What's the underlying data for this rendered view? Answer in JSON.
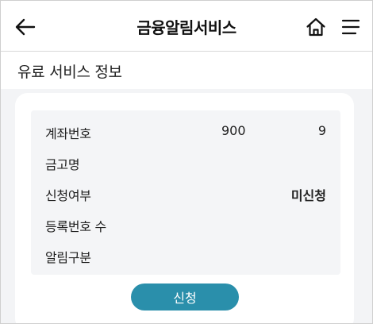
{
  "header": {
    "title": "금융알림서비스",
    "back_icon": "arrow-left-icon",
    "home_icon": "home-icon",
    "menu_icon": "hamburger-menu-icon"
  },
  "section": {
    "title": "유료 서비스 정보"
  },
  "info": {
    "rows": [
      {
        "label": "계좌번호",
        "value_mid": "900",
        "value_right": "9"
      },
      {
        "label": "금고명",
        "value_right": ""
      },
      {
        "label": "신청여부",
        "value_right": "미신청"
      },
      {
        "label": "등록번호 수",
        "value_right": ""
      },
      {
        "label": "알림구분",
        "value_right": ""
      }
    ]
  },
  "actions": {
    "apply_label": "신청",
    "apply_color": "#2a8fab"
  }
}
